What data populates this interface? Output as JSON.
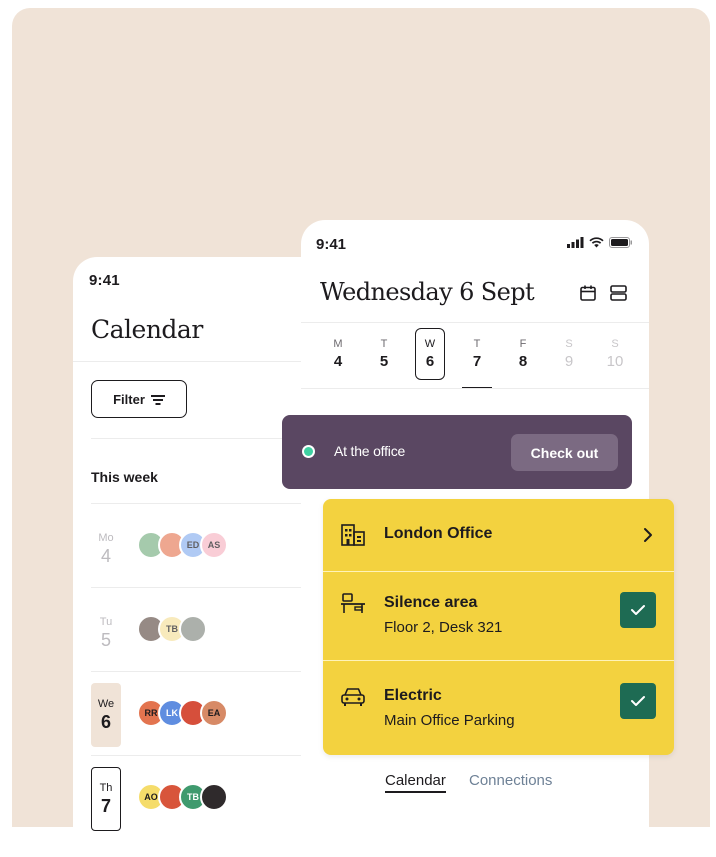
{
  "calendar_screen": {
    "time": "9:41",
    "title": "Calendar",
    "filter_label": "Filter",
    "week_label": "This week",
    "days": [
      {
        "abbr": "Mo",
        "num": "4",
        "state": "past",
        "avatars": [
          {
            "initials": "",
            "color": "#7fb48a"
          },
          {
            "initials": "",
            "color": "#e88262"
          },
          {
            "initials": "ED",
            "color": "#8fb5f0"
          },
          {
            "initials": "AS",
            "color": "#f7b8c6"
          }
        ]
      },
      {
        "abbr": "Tu",
        "num": "5",
        "state": "past",
        "avatars": [
          {
            "initials": "",
            "color": "#6a5a52"
          },
          {
            "initials": "TB",
            "color": "#f6e2a0"
          },
          {
            "initials": "",
            "color": "#8a8f88"
          }
        ]
      },
      {
        "abbr": "We",
        "num": "6",
        "state": "today",
        "avatars": [
          {
            "initials": "RR",
            "color": "#e3744f"
          },
          {
            "initials": "LK",
            "color": "#5f8de0"
          },
          {
            "initials": "",
            "color": "#d64f3b"
          },
          {
            "initials": "EA",
            "color": "#d78a66"
          }
        ]
      },
      {
        "abbr": "Th",
        "num": "7",
        "state": "selected",
        "avatars": [
          {
            "initials": "AO",
            "color": "#f5dc6a"
          },
          {
            "initials": "",
            "color": "#d8553b"
          },
          {
            "initials": "TB",
            "color": "#3f9a6e"
          },
          {
            "initials": "",
            "color": "#2f2a2c"
          }
        ]
      }
    ]
  },
  "day_screen": {
    "time": "9:41",
    "title": "Wednesday 6 Sept",
    "week": [
      {
        "label": "M",
        "num": "4",
        "state": "normal"
      },
      {
        "label": "T",
        "num": "5",
        "state": "normal"
      },
      {
        "label": "W",
        "num": "6",
        "state": "selected"
      },
      {
        "label": "T",
        "num": "7",
        "state": "normal"
      },
      {
        "label": "F",
        "num": "8",
        "state": "normal"
      },
      {
        "label": "S",
        "num": "9",
        "state": "off"
      },
      {
        "label": "S",
        "num": "10",
        "state": "off"
      }
    ],
    "tabs": {
      "active": "Calendar",
      "other": "Connections"
    }
  },
  "office_banner": {
    "status_text": "At the office",
    "checkout_label": "Check out",
    "status_color": "#3fd1a2"
  },
  "booking": {
    "location": {
      "title": "London Office",
      "icon": "building-icon"
    },
    "desk": {
      "title": "Silence area",
      "subtitle": "Floor 2, Desk 321",
      "icon": "desk-icon"
    },
    "parking": {
      "title": "Electric",
      "subtitle": "Main Office Parking",
      "icon": "car-icon"
    }
  },
  "colors": {
    "background": "#f0e3d7",
    "banner": "#5a4762",
    "card": "#f3d23f",
    "check": "#1e6b53"
  }
}
